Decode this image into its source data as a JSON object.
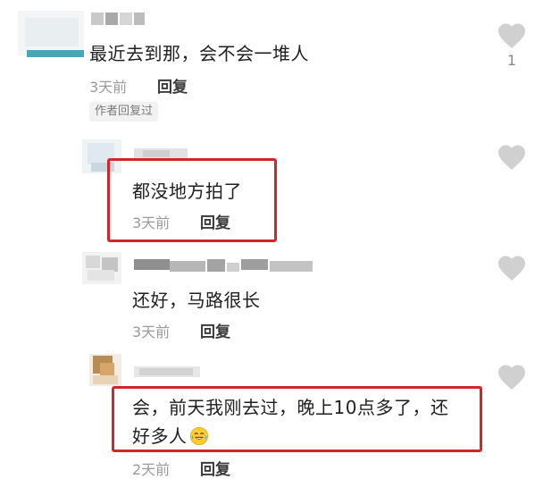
{
  "comments": [
    {
      "text": "最近去到那，会不会一堆人",
      "time": "3天前",
      "reply_label": "回复",
      "author_tag": "作者回复过",
      "likes": "1"
    },
    {
      "text": "都没地方拍了",
      "time": "3天前",
      "reply_label": "回复"
    },
    {
      "text": "还好，马路很长",
      "time": "3天前",
      "reply_label": "回复"
    },
    {
      "text_line1": "会，前天我刚去过，晚上10点多了，还",
      "text_line2": "好多人",
      "time": "2天前",
      "reply_label": "回复"
    }
  ],
  "icons": {
    "like": "heart-icon",
    "emoji": "laughing-tears-emoji"
  },
  "colors": {
    "highlight_box": "#d3262c",
    "heart": "#d0d0d0"
  }
}
